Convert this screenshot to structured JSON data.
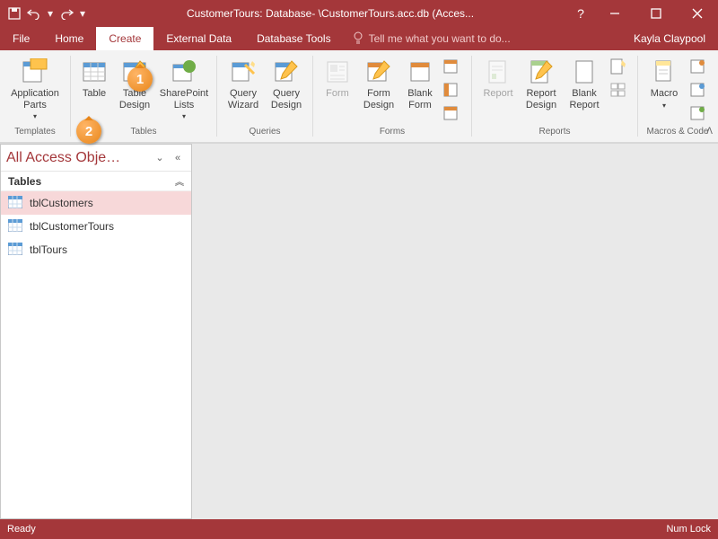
{
  "titlebar": {
    "title": "CustomerTours: Database- \\CustomerTours.acc.db (Acces..."
  },
  "tabs": {
    "file": "File",
    "home": "Home",
    "create": "Create",
    "external": "External Data",
    "db_tools": "Database Tools",
    "tell_me": "Tell me what you want to do..."
  },
  "user_name": "Kayla Claypool",
  "ribbon": {
    "templates": {
      "group_label": "Templates",
      "application_parts": "Application\nParts"
    },
    "tables": {
      "group_label": "Tables",
      "table": "Table",
      "table_design": "Table\nDesign",
      "sharepoint_lists": "SharePoint\nLists"
    },
    "queries": {
      "group_label": "Queries",
      "query_wizard": "Query\nWizard",
      "query_design": "Query\nDesign"
    },
    "forms": {
      "group_label": "Forms",
      "form": "Form",
      "form_design": "Form\nDesign",
      "blank_form": "Blank\nForm"
    },
    "reports": {
      "group_label": "Reports",
      "report": "Report",
      "report_design": "Report\nDesign",
      "blank_report": "Blank\nReport"
    },
    "macros": {
      "group_label": "Macros & Code",
      "macro": "Macro"
    }
  },
  "nav": {
    "header": "All Access Obje…",
    "group": "Tables",
    "items": [
      "tblCustomers",
      "tblCustomerTours",
      "tblTours"
    ]
  },
  "status": {
    "left": "Ready",
    "right": "Num Lock"
  },
  "callouts": {
    "one": "1",
    "two": "2"
  }
}
